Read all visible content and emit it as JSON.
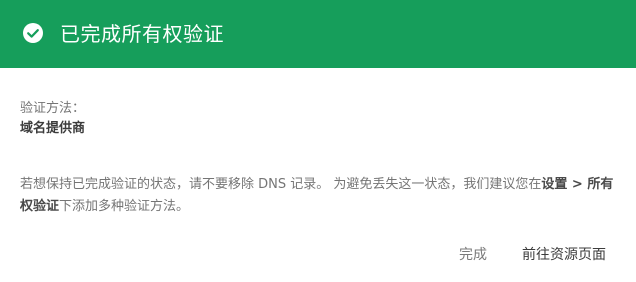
{
  "header": {
    "title": "已完成所有权验证",
    "icon": "check-circle-icon",
    "color": "#169e5b"
  },
  "verification": {
    "method_label": "验证方法：",
    "method_value": "域名提供商"
  },
  "message": {
    "part1": "若想保持已完成验证的状态，请不要移除 DNS 记录。 为避免丢失这一状态，我们建议您在",
    "path": "设置 > 所有权验证",
    "part2": "下添加多种验证方法。"
  },
  "actions": {
    "done_label": "完成",
    "goto_label": "前往资源页面"
  }
}
